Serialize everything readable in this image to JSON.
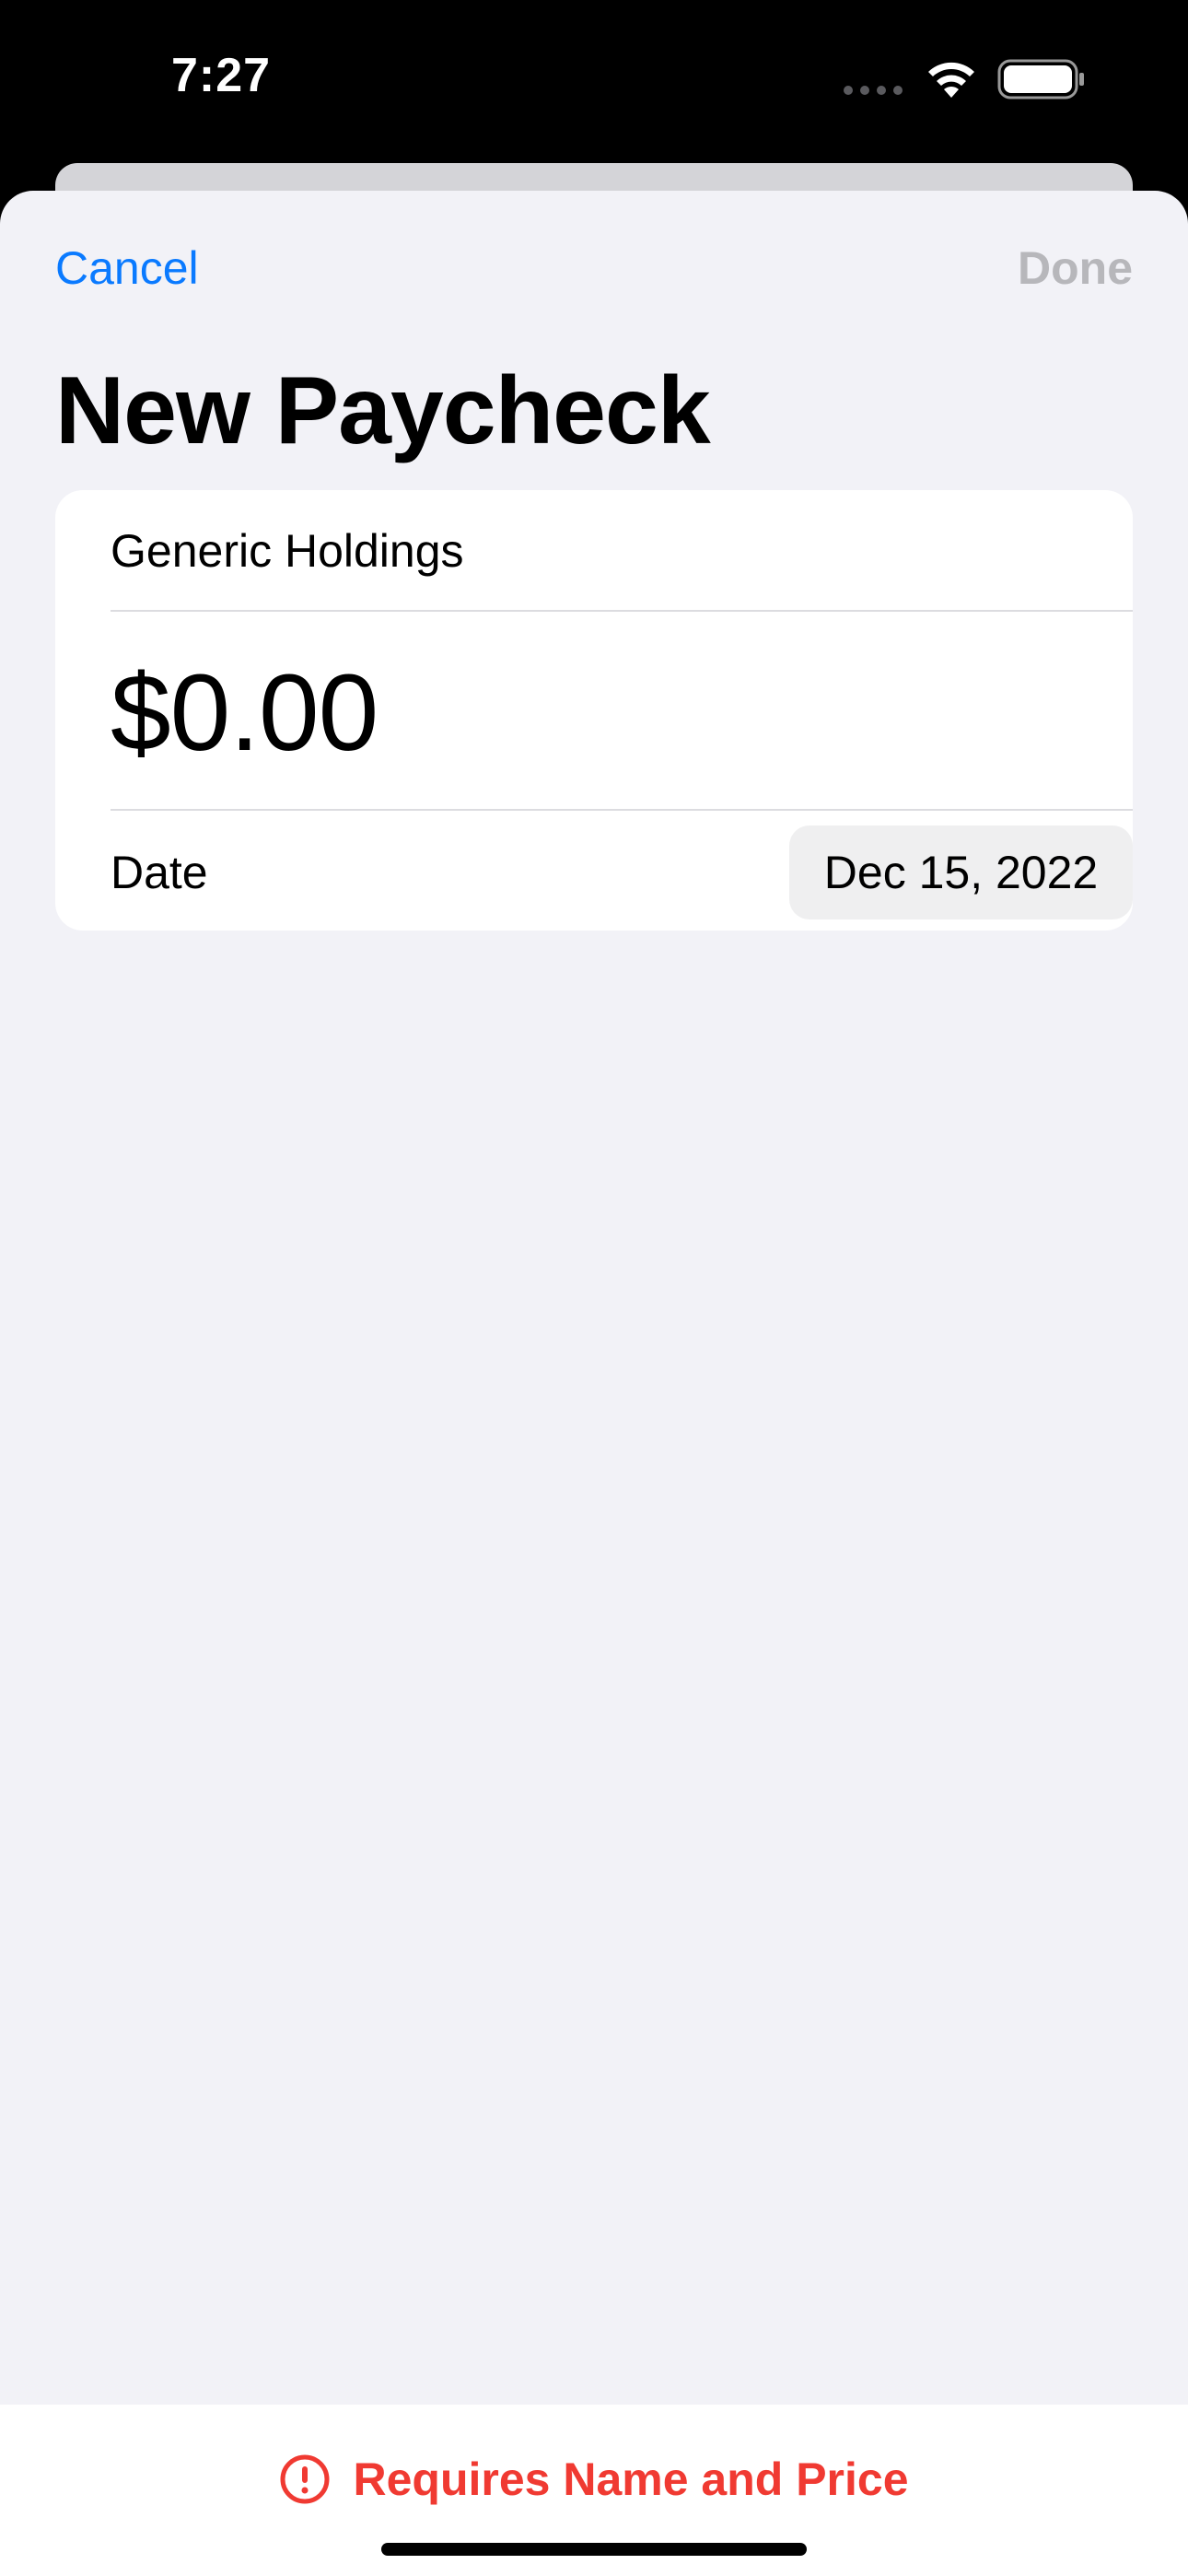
{
  "status_bar": {
    "time": "7:27",
    "icons": [
      "cellular-signal-icon",
      "wifi-icon",
      "battery-icon"
    ]
  },
  "nav": {
    "cancel_label": "Cancel",
    "done_label": "Done"
  },
  "page": {
    "title": "New Paycheck"
  },
  "form": {
    "name_value": "Generic Holdings",
    "amount_value": "$0.00",
    "date_label": "Date",
    "date_value": "Dec 15, 2022"
  },
  "footer": {
    "warning_icon": "exclamation-circle-icon",
    "warning_text": "Requires Name and Price"
  },
  "colors": {
    "accent": "#0a7aff",
    "disabled": "#b7b7bb",
    "warning": "#f03a32",
    "background": "#f2f2f7"
  }
}
